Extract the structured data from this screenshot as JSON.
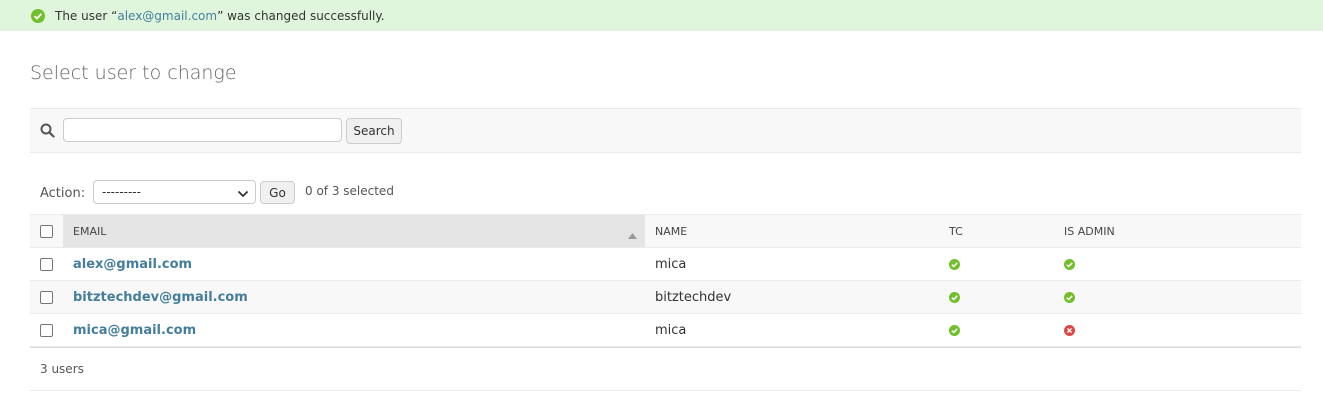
{
  "message": {
    "prefix": "The user “",
    "link": "alex@gmail.com",
    "suffix": "” was changed successfully.",
    "icon": "check-circle-icon",
    "color": "#70bf2b"
  },
  "page_title": "Select user to change",
  "search": {
    "value": "",
    "placeholder": "",
    "button_label": "Search",
    "icon": "search-icon"
  },
  "actions": {
    "label": "Action:",
    "selected": "---------",
    "go_label": "Go",
    "counter": "0 of 3 selected"
  },
  "table": {
    "headers": {
      "email": "EMAIL",
      "name": "NAME",
      "tc": "TC",
      "is_admin": "IS ADMIN"
    },
    "rows": [
      {
        "email": "alex@gmail.com",
        "name": "mica",
        "tc": true,
        "is_admin": true
      },
      {
        "email": "bitztechdev@gmail.com",
        "name": "bitztechdev",
        "tc": true,
        "is_admin": true
      },
      {
        "email": "mica@gmail.com",
        "name": "mica",
        "tc": true,
        "is_admin": false
      }
    ]
  },
  "paginator": {
    "count_text": "3 users"
  },
  "colors": {
    "link": "#447e9b",
    "true": "#70bf2b",
    "false": "#dd4646",
    "success_bg": "#dff6dd"
  }
}
